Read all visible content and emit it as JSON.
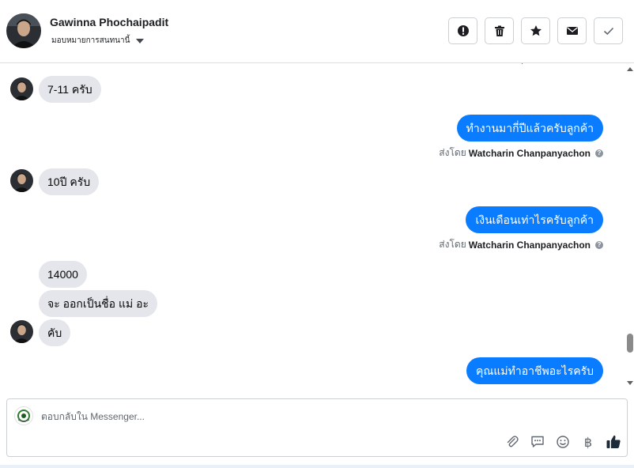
{
  "header": {
    "name": "Gawinna Phochaipadit",
    "assign_label": "มอบหมายการสนทนานี้"
  },
  "actions": [
    {
      "name": "report",
      "icon": "exclamation-icon"
    },
    {
      "name": "delete",
      "icon": "trash-icon"
    },
    {
      "name": "star",
      "icon": "star-icon"
    },
    {
      "name": "mark-unread",
      "icon": "envelope-icon"
    },
    {
      "name": "done",
      "icon": "check-icon"
    }
  ],
  "messages": [
    {
      "dir": "in",
      "text": "7-11 ครับ"
    },
    {
      "dir": "out",
      "text": "ทำงานมากี่ปีแล้วครับลูกค้า",
      "sent_by_prefix": "ส่งโดย",
      "sent_by": "Watcharin Chanpanyachon"
    },
    {
      "dir": "in",
      "text": "10ปี ครับ"
    },
    {
      "dir": "out",
      "text": "เงินเดือนเท่าไรครับลูกค้า",
      "sent_by_prefix": "ส่งโดย",
      "sent_by": "Watcharin Chanpanyachon"
    },
    {
      "dir": "in",
      "text": "14000"
    },
    {
      "dir": "in",
      "text": "จะ ออกเป็นชื่อ แม่ อะ"
    },
    {
      "dir": "in",
      "text": "คับ"
    },
    {
      "dir": "out",
      "text": "คุณแม่ทำอาชีพอะไรครับ"
    }
  ],
  "composer": {
    "placeholder": "ตอบกลับใน Messenger...",
    "baht_symbol": "฿"
  },
  "colors": {
    "outgoing": "#0a7cff",
    "incoming": "#e4e6eb"
  }
}
